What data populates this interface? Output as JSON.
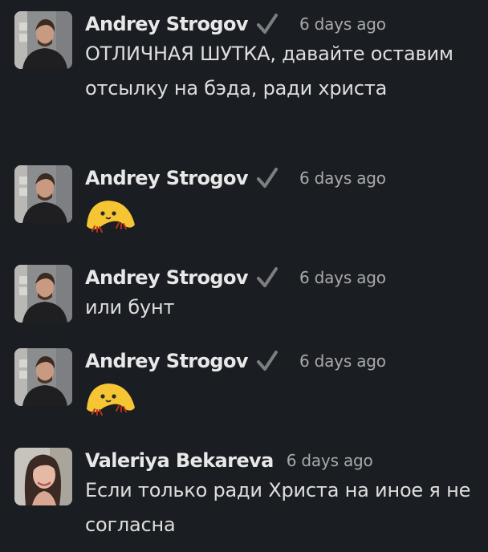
{
  "messages": [
    {
      "author": "Andrey Strogov",
      "verified": true,
      "time": "6 days ago",
      "text": "ОТЛИЧНАЯ ШУТКА, давайте оставим отсылку на бэда, ради христа"
    },
    {
      "author": "Andrey Strogov",
      "verified": true,
      "time": "6 days ago",
      "emoji": "yellow-blob-emoji"
    },
    {
      "author": "Andrey Strogov",
      "verified": true,
      "time": "6 days ago",
      "text": "или бунт"
    },
    {
      "author": "Andrey Strogov",
      "verified": true,
      "time": "6 days ago",
      "emoji": "yellow-blob-emoji"
    },
    {
      "author": "Valeriya Bekareva",
      "verified": false,
      "time": "6 days ago",
      "text": "Если только ради Христа на иное я не согласна"
    }
  ],
  "colors": {
    "background": "#1a1d21",
    "author": "#e8e8e8",
    "text": "#dedede",
    "timestamp": "#a9a9ab",
    "emoji": "#f5c533"
  }
}
